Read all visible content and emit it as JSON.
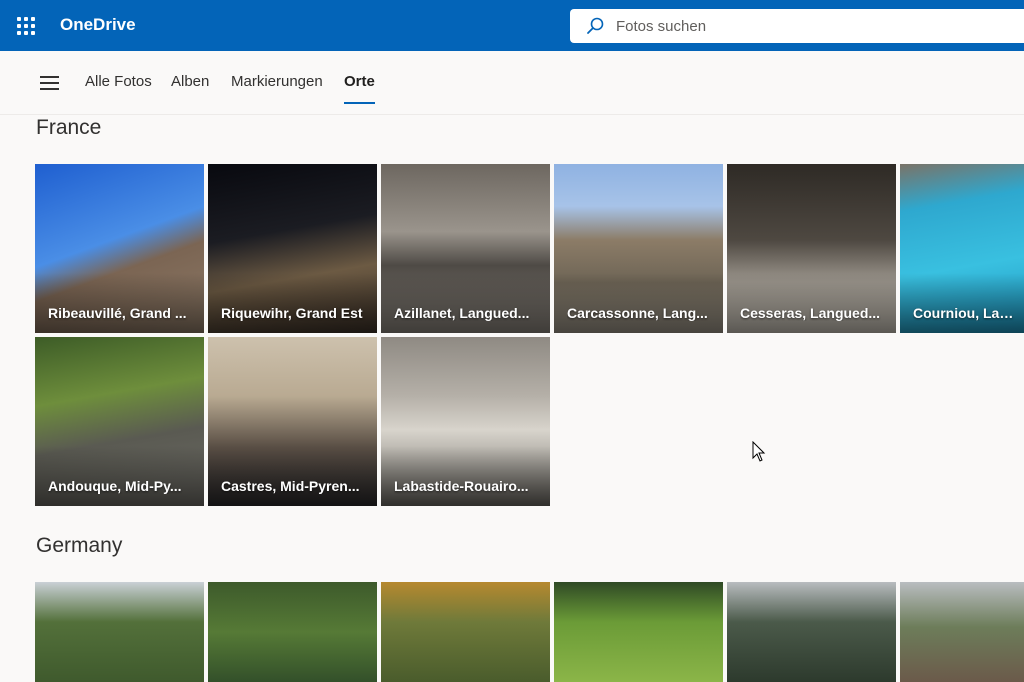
{
  "app": {
    "title": "OneDrive"
  },
  "search": {
    "placeholder": "Fotos suchen"
  },
  "nav": {
    "tabs": [
      {
        "label": "Alle Fotos",
        "active": false
      },
      {
        "label": "Alben",
        "active": false
      },
      {
        "label": "Markierungen",
        "active": false
      },
      {
        "label": "Orte",
        "active": true
      }
    ]
  },
  "sections": [
    {
      "title": "France",
      "places": [
        "Ribeauvillé, Grand ...",
        "Riquewihr, Grand Est",
        "Azillanet, Langued...",
        "Carcassonne, Lang...",
        "Cesseras, Langued...",
        "Courniou, Langu",
        "Andouque, Mid-Py...",
        "Castres, Mid-Pyren...",
        "Labastide-Rouairo..."
      ]
    },
    {
      "title": "Germany",
      "places": [
        "",
        "",
        "",
        "",
        "",
        ""
      ]
    }
  ],
  "colors": {
    "topbar": "#0364b8",
    "accent": "#0364b8"
  },
  "icons": {
    "app_launcher": "waffle-icon",
    "search": "search-icon",
    "menu": "hamburger-icon",
    "pointer": "mouse-cursor-icon"
  }
}
